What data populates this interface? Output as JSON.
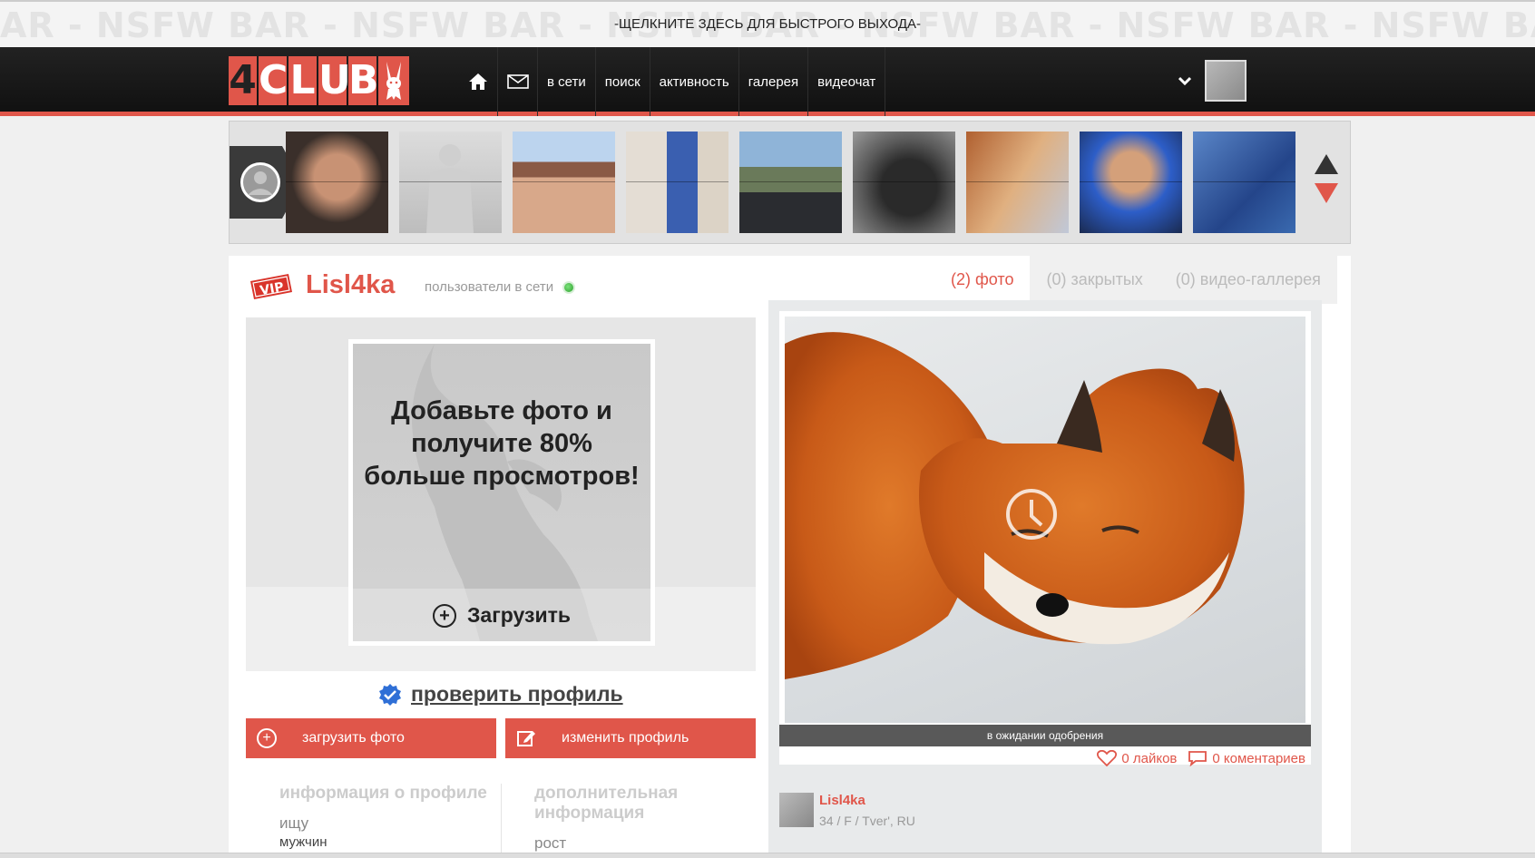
{
  "nsfw_bar": {
    "watermark": "AR - NSFW BAR - NSFW BAR - NSFW BAR - NSFW BAR - NSFW BAR - NSFW BAR - NSFW BAR - NSFW BAR - NSFW BAR - NSFW BAR - NSFW",
    "text": "-ЩЕЛКНИТЕ ЗДЕСЬ ДЛЯ БЫСТРОГО ВЫХОДА-"
  },
  "header": {
    "logo_letters": [
      "4",
      "C",
      "L",
      "U",
      "B"
    ],
    "nav": {
      "home_icon": "home-icon",
      "mail_icon": "envelope-icon",
      "items": [
        {
          "label": "в сети"
        },
        {
          "label": "поиск"
        },
        {
          "label": "активность"
        },
        {
          "label": "галерея"
        },
        {
          "label": "видеочат"
        }
      ]
    },
    "dropdown_icon": "chevron-down-icon"
  },
  "carousel": {
    "thumb_count": 9,
    "up_icon": "arrow-up-icon",
    "down_icon": "arrow-down-icon"
  },
  "profile": {
    "vip_label": "VIP",
    "username": "Lisl4ka",
    "online_text": "пользователи в сети",
    "tabs": [
      {
        "label": "(2) фото",
        "active": true
      },
      {
        "label": "(0) закрытых",
        "active": false
      },
      {
        "label": "(0) видео-галлерея",
        "active": false
      }
    ],
    "upload_prompt": "Добавьте фото и получите 80% больше просмотров!",
    "upload_button": "Загрузить",
    "verify_link": "проверить профиль",
    "upload_photo_button": "загрузить фото",
    "edit_profile_button": "изменить профиль",
    "info": {
      "heading": "информация о профиле",
      "label": "ищу",
      "value": "мужчин"
    },
    "extra": {
      "heading": "дополнительная информация",
      "label": "рост"
    }
  },
  "photo": {
    "status": "в ожидании одобрения",
    "likes": "0 лайков",
    "comments": "0 коментариев",
    "uploader_name": "Lisl4ka",
    "uploader_meta": "34 / F / Tver', RU"
  },
  "colors": {
    "accent": "#e0564a",
    "header_bg": "#1a1a1a",
    "online": "#2ca02c"
  }
}
